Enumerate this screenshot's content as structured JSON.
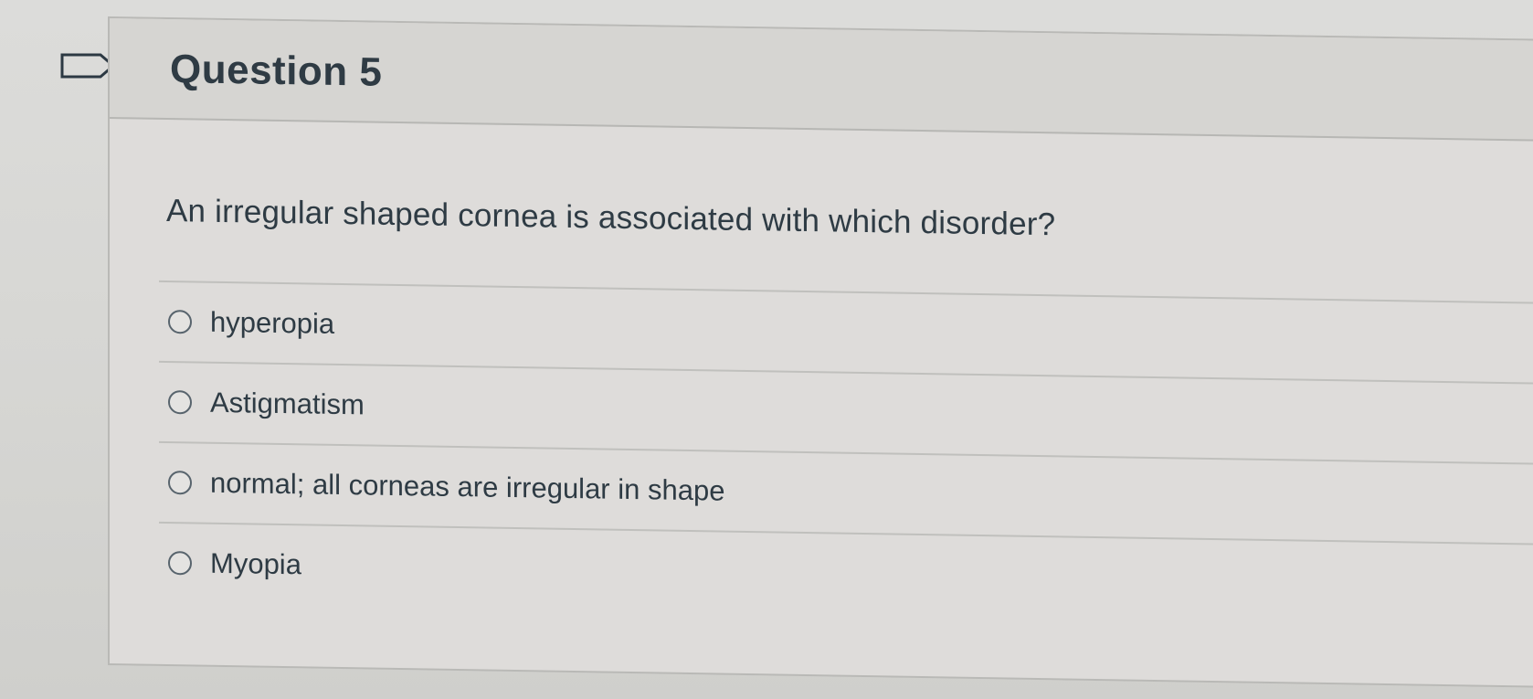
{
  "question": {
    "title": "Question 5",
    "text": "An irregular shaped cornea is associated with which disorder?",
    "answers": [
      {
        "label": "hyperopia"
      },
      {
        "label": "Astigmatism"
      },
      {
        "label": "normal; all corneas are irregular in shape"
      },
      {
        "label": "Myopia"
      }
    ]
  },
  "icons": {
    "flag": "bookmark-flag-icon",
    "radio": "radio-unchecked-icon"
  },
  "colors": {
    "text": "#2d3b45",
    "border": "#b9b9b6",
    "background": "#d8d8d6"
  }
}
